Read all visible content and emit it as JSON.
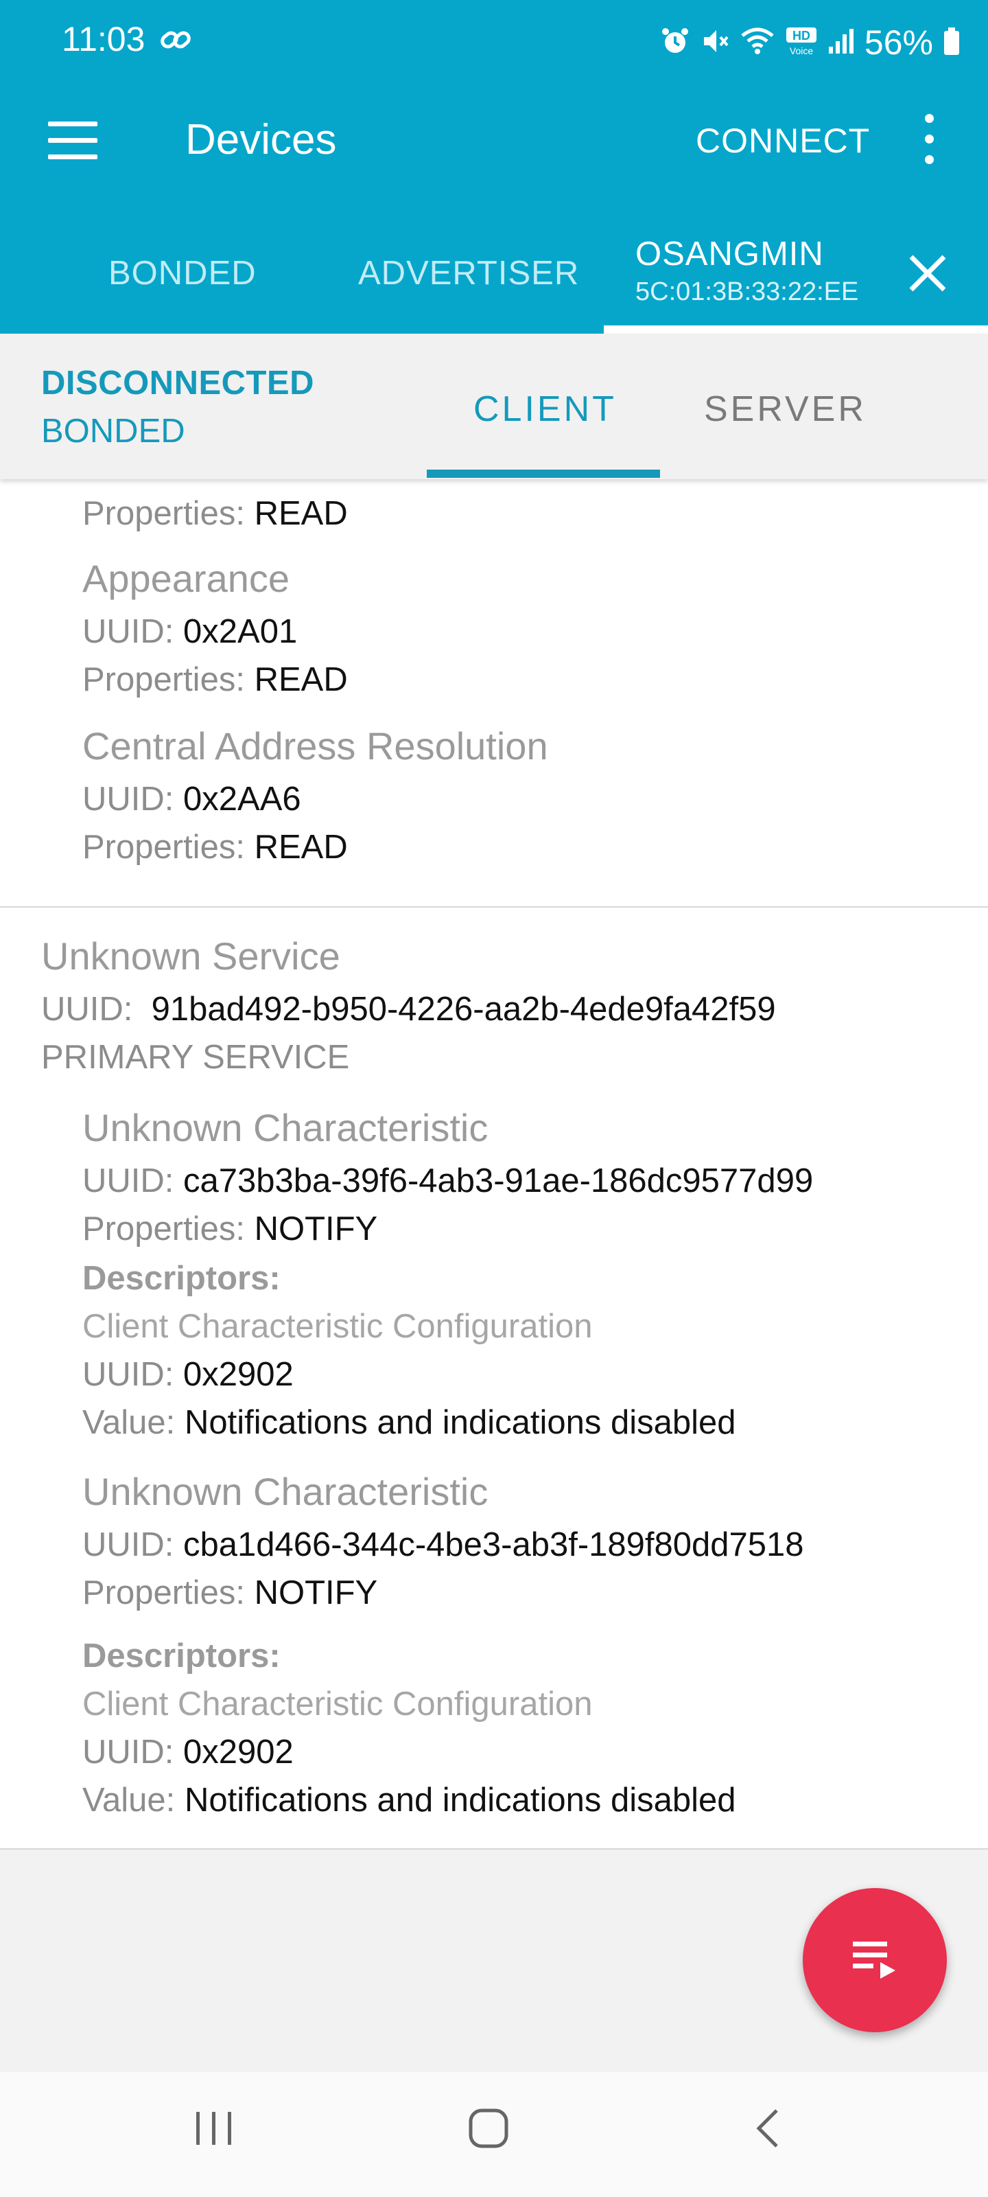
{
  "status_bar": {
    "time": "11:03",
    "battery": "56%",
    "icons": [
      "link-icon",
      "alarm-icon",
      "mute-icon",
      "wifi-icon",
      "hd-voice-icon",
      "signal-icon",
      "battery-icon"
    ]
  },
  "app_bar": {
    "title": "Devices",
    "connect": "CONNECT",
    "menu_icon": "menu-icon",
    "more_icon": "more-vert-icon"
  },
  "device_tabs": {
    "bonded": "BONDED",
    "advertiser": "ADVERTISER",
    "device_name": "OSANGMIN",
    "device_address": "5C:01:3B:33:22:EE"
  },
  "connection": {
    "state": "DISCONNECTED",
    "bond": "BONDED"
  },
  "sub_tabs": {
    "client": "CLIENT",
    "server": "SERVER"
  },
  "labels": {
    "uuid": "UUID:",
    "properties": "Properties:",
    "descriptors": "Descriptors:",
    "value": "Value:"
  },
  "card1": {
    "top_properties": "READ",
    "characteristics": [
      {
        "name": "Appearance",
        "uuid": "0x2A01",
        "properties": "READ"
      },
      {
        "name": "Central Address Resolution",
        "uuid": "0x2AA6",
        "properties": "READ"
      }
    ]
  },
  "service": {
    "name": "Unknown Service",
    "uuid": "91bad492-b950-4226-aa2b-4ede9fa42f59",
    "type": "PRIMARY SERVICE",
    "characteristics": [
      {
        "name": "Unknown Characteristic",
        "uuid": "ca73b3ba-39f6-4ab3-91ae-186dc9577d99",
        "properties": "NOTIFY",
        "descriptor_name": "Client Characteristic Configuration",
        "descriptor_uuid": "0x2902",
        "descriptor_value": "Notifications and indications disabled"
      },
      {
        "name": "Unknown Characteristic",
        "uuid": "cba1d466-344c-4be3-ab3f-189f80dd7518",
        "properties": "NOTIFY",
        "descriptor_name": "Client Characteristic Configuration",
        "descriptor_uuid": "0x2902",
        "descriptor_value": "Notifications and indications disabled"
      }
    ]
  },
  "colors": {
    "primary": "#06a6cb",
    "accent_text": "#1599bb",
    "fab": "#e9304f"
  },
  "fab_icon": "log-list-icon",
  "nav_icons": [
    "recent-apps-icon",
    "home-icon",
    "back-icon"
  ]
}
